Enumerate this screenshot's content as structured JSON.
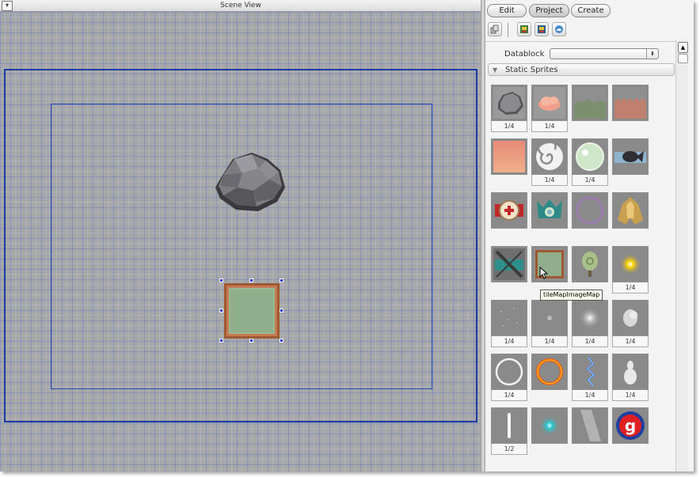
{
  "scene": {
    "title": "Scene View",
    "menu_glyph": "▾"
  },
  "tabs": [
    "Edit",
    "Project",
    "Create"
  ],
  "toolbar_icons": [
    "objects-icon",
    "scene-image-icon",
    "scene-image-alt-icon",
    "cloud-icon"
  ],
  "datablock": {
    "label": "Datablock",
    "value": ""
  },
  "section": {
    "title": "Static Sprites"
  },
  "tooltip": "tileMapImageMap",
  "assets": [
    {
      "name": "asteroid",
      "frames": "1/4"
    },
    {
      "name": "pink-cloud",
      "frames": "1/4"
    },
    {
      "name": "green-hills",
      "frames": ""
    },
    {
      "name": "red-grass",
      "frames": ""
    },
    {
      "name": "pink-gradient",
      "frames": ""
    },
    {
      "name": "white-swirl",
      "frames": "1/4"
    },
    {
      "name": "green-bubble",
      "frames": "1/4"
    },
    {
      "name": "dark-fish",
      "frames": ""
    },
    {
      "name": "health-pack",
      "frames": ""
    },
    {
      "name": "crown-ship",
      "frames": ""
    },
    {
      "name": "purple-ring",
      "frames": ""
    },
    {
      "name": "gold-ship",
      "frames": ""
    },
    {
      "name": "teal-ship-broken",
      "frames": ""
    },
    {
      "name": "tile-map-image",
      "frames": ""
    },
    {
      "name": "tree",
      "frames": ""
    },
    {
      "name": "star-glow",
      "frames": "1/4"
    },
    {
      "name": "sparkle-dots",
      "frames": "1/4"
    },
    {
      "name": "small-dot",
      "frames": "1/4"
    },
    {
      "name": "white-glow",
      "frames": "1/4"
    },
    {
      "name": "smoke-puff",
      "frames": "1/4"
    },
    {
      "name": "white-ring",
      "frames": "1/4"
    },
    {
      "name": "fire-ring",
      "frames": ""
    },
    {
      "name": "lightning",
      "frames": "1/4"
    },
    {
      "name": "white-smoke",
      "frames": "1/4"
    },
    {
      "name": "light-bar",
      "frames": "1/2"
    },
    {
      "name": "cyan-glow",
      "frames": ""
    },
    {
      "name": "light-streak",
      "frames": ""
    },
    {
      "name": "g-logo",
      "frames": ""
    }
  ]
}
